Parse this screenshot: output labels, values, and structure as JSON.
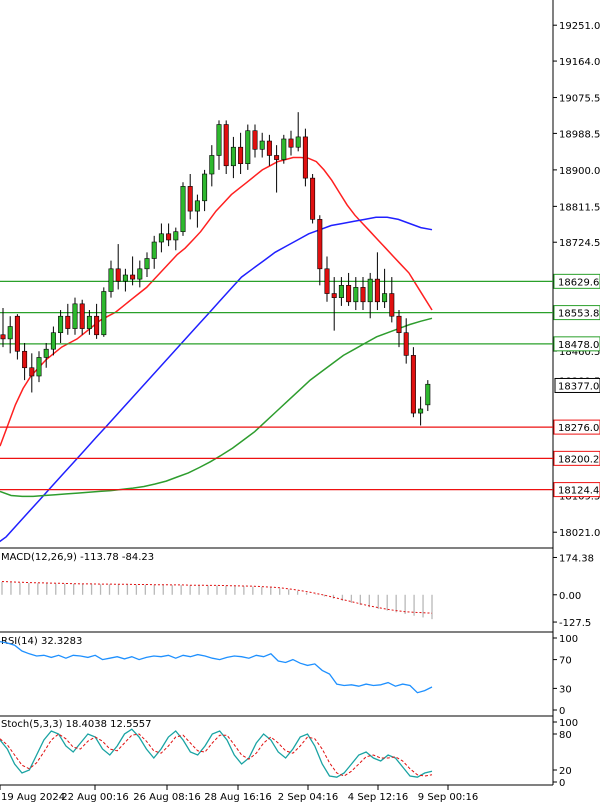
{
  "chart_data": [
    {
      "type": "candlestick",
      "panel": "price",
      "price_axis_ticks": [
        19251.0,
        19164.0,
        19075.5,
        18988.5,
        18900.0,
        18811.5,
        18724.5,
        18460.5,
        18021.0
      ],
      "partial_ticks": [
        "18636.5",
        "18389.5",
        "18109.5"
      ],
      "ylim": [
        17990,
        19300
      ],
      "x_tick_labels": [
        "19 Aug 2024",
        "22 Aug 00:16",
        "26 Aug 08:16",
        "28 Aug 16:16",
        "2 Sep 04:16",
        "4 Sep 12:16",
        "9 Sep 00:16"
      ],
      "candles": [
        {
          "o": 18500,
          "h": 18565,
          "l": 18470,
          "c": 18490
        },
        {
          "o": 18490,
          "h": 18545,
          "l": 18455,
          "c": 18520
        },
        {
          "o": 18545,
          "h": 18550,
          "l": 18440,
          "c": 18460
        },
        {
          "o": 18460,
          "h": 18480,
          "l": 18390,
          "c": 18420
        },
        {
          "o": 18420,
          "h": 18455,
          "l": 18360,
          "c": 18400
        },
        {
          "o": 18400,
          "h": 18460,
          "l": 18385,
          "c": 18445
        },
        {
          "o": 18445,
          "h": 18480,
          "l": 18420,
          "c": 18465
        },
        {
          "o": 18465,
          "h": 18520,
          "l": 18450,
          "c": 18505
        },
        {
          "o": 18505,
          "h": 18560,
          "l": 18480,
          "c": 18545
        },
        {
          "o": 18545,
          "h": 18575,
          "l": 18500,
          "c": 18515
        },
        {
          "o": 18515,
          "h": 18590,
          "l": 18500,
          "c": 18575
        },
        {
          "o": 18575,
          "h": 18585,
          "l": 18500,
          "c": 18515
        },
        {
          "o": 18515,
          "h": 18560,
          "l": 18500,
          "c": 18545
        },
        {
          "o": 18545,
          "h": 18575,
          "l": 18490,
          "c": 18500
        },
        {
          "o": 18500,
          "h": 18615,
          "l": 18495,
          "c": 18605
        },
        {
          "o": 18605,
          "h": 18680,
          "l": 18590,
          "c": 18660
        },
        {
          "o": 18660,
          "h": 18720,
          "l": 18610,
          "c": 18630
        },
        {
          "o": 18630,
          "h": 18660,
          "l": 18605,
          "c": 18645
        },
        {
          "o": 18645,
          "h": 18690,
          "l": 18620,
          "c": 18635
        },
        {
          "o": 18635,
          "h": 18680,
          "l": 18615,
          "c": 18660
        },
        {
          "o": 18660,
          "h": 18700,
          "l": 18640,
          "c": 18685
        },
        {
          "o": 18685,
          "h": 18740,
          "l": 18660,
          "c": 18725
        },
        {
          "o": 18725,
          "h": 18770,
          "l": 18700,
          "c": 18745
        },
        {
          "o": 18745,
          "h": 18770,
          "l": 18715,
          "c": 18730
        },
        {
          "o": 18730,
          "h": 18760,
          "l": 18705,
          "c": 18750
        },
        {
          "o": 18750,
          "h": 18870,
          "l": 18740,
          "c": 18860
        },
        {
          "o": 18860,
          "h": 18890,
          "l": 18780,
          "c": 18800
        },
        {
          "o": 18800,
          "h": 18840,
          "l": 18760,
          "c": 18825
        },
        {
          "o": 18825,
          "h": 18900,
          "l": 18800,
          "c": 18890
        },
        {
          "o": 18890,
          "h": 18960,
          "l": 18860,
          "c": 18935
        },
        {
          "o": 18935,
          "h": 19020,
          "l": 18900,
          "c": 19010
        },
        {
          "o": 19010,
          "h": 19020,
          "l": 18890,
          "c": 18910
        },
        {
          "o": 18910,
          "h": 18980,
          "l": 18880,
          "c": 18955
        },
        {
          "o": 18955,
          "h": 18990,
          "l": 18890,
          "c": 18915
        },
        {
          "o": 18915,
          "h": 19010,
          "l": 18900,
          "c": 18995
        },
        {
          "o": 18995,
          "h": 19010,
          "l": 18930,
          "c": 18950
        },
        {
          "o": 18950,
          "h": 18990,
          "l": 18930,
          "c": 18970
        },
        {
          "o": 18970,
          "h": 18985,
          "l": 18910,
          "c": 18935
        },
        {
          "o": 18935,
          "h": 18960,
          "l": 18845,
          "c": 18925
        },
        {
          "o": 18925,
          "h": 18985,
          "l": 18915,
          "c": 18975
        },
        {
          "o": 18975,
          "h": 18995,
          "l": 18935,
          "c": 18955
        },
        {
          "o": 18955,
          "h": 19040,
          "l": 18945,
          "c": 18980
        },
        {
          "o": 18980,
          "h": 19000,
          "l": 18860,
          "c": 18880
        },
        {
          "o": 18880,
          "h": 18890,
          "l": 18770,
          "c": 18780
        },
        {
          "o": 18780,
          "h": 18790,
          "l": 18620,
          "c": 18660
        },
        {
          "o": 18660,
          "h": 18690,
          "l": 18580,
          "c": 18600
        },
        {
          "o": 18600,
          "h": 18640,
          "l": 18510,
          "c": 18590
        },
        {
          "o": 18590,
          "h": 18640,
          "l": 18570,
          "c": 18620
        },
        {
          "o": 18620,
          "h": 18650,
          "l": 18570,
          "c": 18580
        },
        {
          "o": 18580,
          "h": 18640,
          "l": 18560,
          "c": 18615
        },
        {
          "o": 18615,
          "h": 18640,
          "l": 18560,
          "c": 18580
        },
        {
          "o": 18580,
          "h": 18650,
          "l": 18540,
          "c": 18635
        },
        {
          "o": 18635,
          "h": 18700,
          "l": 18560,
          "c": 18580
        },
        {
          "o": 18580,
          "h": 18660,
          "l": 18565,
          "c": 18600
        },
        {
          "o": 18600,
          "h": 18640,
          "l": 18530,
          "c": 18545
        },
        {
          "o": 18545,
          "h": 18560,
          "l": 18470,
          "c": 18505
        },
        {
          "o": 18505,
          "h": 18540,
          "l": 18430,
          "c": 18450
        },
        {
          "o": 18450,
          "h": 18470,
          "l": 18300,
          "c": 18310
        },
        {
          "o": 18310,
          "h": 18350,
          "l": 18280,
          "c": 18320
        },
        {
          "o": 18330,
          "h": 18390,
          "l": 18315,
          "c": 18380
        }
      ],
      "moving_averages": [
        {
          "color": "#ff2020",
          "values": [
            18230,
            18280,
            18330,
            18370,
            18400,
            18420,
            18440,
            18455,
            18470,
            18480,
            18490,
            18505,
            18520,
            18535,
            18545,
            18555,
            18570,
            18585,
            18600,
            18615,
            18635,
            18655,
            18675,
            18695,
            18710,
            18730,
            18750,
            18775,
            18800,
            18820,
            18840,
            18855,
            18870,
            18885,
            18900,
            18910,
            18920,
            18925,
            18930,
            18930,
            18928,
            18920,
            18900,
            18875,
            18845,
            18815,
            18790,
            18770,
            18750,
            18730,
            18710,
            18690,
            18670,
            18650,
            18620,
            18590,
            18560
          ]
        },
        {
          "color": "#2020ff",
          "values": [
            17990,
            18010,
            18040,
            18070,
            18100,
            18130,
            18160,
            18190,
            18220,
            18250,
            18280,
            18310,
            18340,
            18370,
            18400,
            18430,
            18460,
            18490,
            18520,
            18550,
            18580,
            18610,
            18640,
            18660,
            18680,
            18700,
            18715,
            18730,
            18745,
            18755,
            18765,
            18770,
            18775,
            18780,
            18785,
            18785,
            18780,
            18770,
            18760,
            18755
          ]
        },
        {
          "color": "#2e9d2e",
          "values": [
            18120,
            18110,
            18108,
            18108,
            18110,
            18112,
            18114,
            18116,
            18118,
            18120,
            18122,
            18125,
            18128,
            18132,
            18138,
            18145,
            18155,
            18165,
            18178,
            18192,
            18208,
            18225,
            18245,
            18265,
            18290,
            18315,
            18340,
            18365,
            18390,
            18410,
            18430,
            18450,
            18465,
            18480,
            18495,
            18505,
            18515,
            18525,
            18533,
            18540
          ]
        }
      ],
      "horizontal_levels": [
        {
          "value": 18629.6,
          "label": "18629.6",
          "color": "#2aa02a"
        },
        {
          "value": 18553.8,
          "label": "18553.8",
          "color": "#2aa02a"
        },
        {
          "value": 18478.0,
          "label": "18478.0",
          "color": "#2aa02a"
        },
        {
          "value": 18276.0,
          "label": "18276.0",
          "color": "#ee1111"
        },
        {
          "value": 18200.2,
          "label": "18200.2",
          "color": "#ee1111"
        },
        {
          "value": 18124.4,
          "label": "18124.4",
          "color": "#ee1111"
        }
      ],
      "current_price": {
        "value": 18377.0,
        "label": "18377.0"
      }
    },
    {
      "type": "histogram",
      "panel": "macd",
      "title": "MACD(12,26,9) -113.78 -84.23",
      "axis_ticks": [
        "174.38",
        "0.00",
        "-127.5"
      ],
      "ylim": [
        -160,
        200
      ],
      "histogram": [
        60,
        58,
        56,
        55,
        54,
        53,
        52,
        52,
        51,
        50,
        50,
        49,
        49,
        48,
        48,
        47,
        47,
        46,
        46,
        45,
        45,
        44,
        44,
        43,
        43,
        42,
        41,
        40,
        38,
        36,
        34,
        30,
        25,
        18,
        10,
        2,
        -8,
        -18,
        -28,
        -38,
        -48,
        -58,
        -66,
        -74,
        -82,
        -90,
        -98,
        -106,
        -114
      ],
      "signal": [
        62,
        60,
        59,
        57,
        56,
        55,
        54,
        53,
        52,
        51,
        51,
        50,
        50,
        49,
        49,
        48,
        48,
        47,
        47,
        46,
        46,
        45,
        45,
        44,
        44,
        43,
        42,
        41,
        40,
        38,
        36,
        33,
        28,
        22,
        15,
        7,
        -2,
        -12,
        -22,
        -32,
        -42,
        -52,
        -60,
        -68,
        -74,
        -79,
        -82,
        -84,
        -86
      ]
    },
    {
      "type": "line",
      "panel": "rsi",
      "title": "RSI(14) 32.3283",
      "axis_ticks": [
        "100",
        "70",
        "30",
        "0"
      ],
      "ylim": [
        0,
        100
      ],
      "values": [
        95,
        93,
        90,
        82,
        78,
        75,
        76,
        73,
        76,
        72,
        76,
        75,
        73,
        76,
        70,
        72,
        74,
        71,
        74,
        70,
        73,
        75,
        74,
        76,
        72,
        76,
        74,
        77,
        75,
        72,
        70,
        73,
        75,
        74,
        72,
        76,
        74,
        78,
        68,
        66,
        70,
        65,
        62,
        64,
        55,
        50,
        36,
        34,
        35,
        33,
        36,
        34,
        35,
        38,
        33,
        36,
        34,
        24,
        27,
        32
      ]
    },
    {
      "type": "line",
      "panel": "stochastic",
      "title": "Stoch(5,3,3) 18.4038 12.5557",
      "axis_ticks": [
        "100",
        "80",
        "20",
        "0"
      ],
      "ylim": [
        0,
        100
      ],
      "k": [
        70,
        55,
        30,
        15,
        20,
        45,
        70,
        85,
        80,
        60,
        50,
        65,
        80,
        75,
        55,
        45,
        60,
        80,
        88,
        75,
        55,
        40,
        55,
        75,
        85,
        70,
        50,
        45,
        60,
        80,
        85,
        70,
        45,
        30,
        40,
        65,
        80,
        70,
        50,
        40,
        55,
        75,
        80,
        60,
        30,
        10,
        8,
        15,
        30,
        45,
        50,
        40,
        35,
        45,
        40,
        25,
        10,
        8,
        15,
        18
      ],
      "d": [
        72,
        62,
        45,
        28,
        22,
        32,
        50,
        70,
        80,
        72,
        58,
        55,
        68,
        75,
        68,
        55,
        52,
        65,
        78,
        80,
        68,
        52,
        48,
        60,
        75,
        78,
        65,
        52,
        50,
        65,
        78,
        78,
        62,
        45,
        38,
        48,
        65,
        75,
        65,
        52,
        48,
        60,
        75,
        72,
        55,
        32,
        15,
        10,
        18,
        30,
        42,
        45,
        40,
        40,
        42,
        35,
        22,
        12,
        10,
        12
      ]
    }
  ]
}
